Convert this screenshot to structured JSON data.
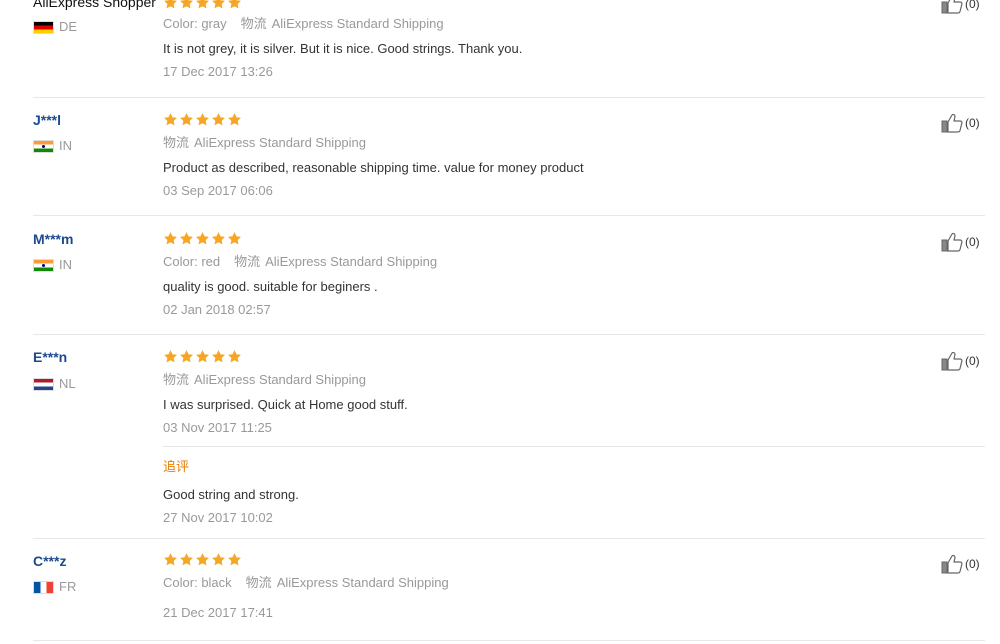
{
  "reviews": [
    {
      "user": "AliExpress Shopper",
      "country": "DE",
      "flag": "de",
      "rating": 5,
      "color_label": "Color:",
      "color": "gray",
      "shipping_label": "物流",
      "shipping": "AliExpress Standard Shipping",
      "text": "It is not grey, it is silver. But it is nice. Good strings. Thank you.",
      "date": "17 Dec 2017 13:26",
      "likes": "(0)"
    },
    {
      "user": "J***l",
      "country": "IN",
      "flag": "in",
      "rating": 5,
      "shipping_label": "物流",
      "shipping": "AliExpress Standard Shipping",
      "text": "Product as described, reasonable shipping time. value for money product",
      "date": "03 Sep 2017 06:06",
      "likes": "(0)"
    },
    {
      "user": "M***m",
      "country": "IN",
      "flag": "in",
      "rating": 5,
      "color_label": "Color:",
      "color": "red",
      "shipping_label": "物流",
      "shipping": "AliExpress Standard Shipping",
      "text": "quality is good. suitable for beginers .",
      "date": "02 Jan 2018 02:57",
      "likes": "(0)"
    },
    {
      "user": "E***n",
      "country": "NL",
      "flag": "nl",
      "rating": 5,
      "shipping_label": "物流",
      "shipping": "AliExpress Standard Shipping",
      "text": "I was surprised. Quick at Home good stuff.",
      "date": "03 Nov 2017 11:25",
      "followup_label": "追评",
      "followup_text": "Good string and strong.",
      "followup_date": "27 Nov 2017 10:02",
      "likes": "(0)"
    },
    {
      "user": "C***z",
      "country": "FR",
      "flag": "fr",
      "rating": 5,
      "color_label": "Color:",
      "color": "black",
      "shipping_label": "物流",
      "shipping": "AliExpress Standard Shipping",
      "date": "21 Dec 2017 17:41",
      "likes": "(0)"
    }
  ],
  "colors": {
    "star": "#f5a623",
    "username": "#1d4a8d",
    "followup": "#e97d00"
  },
  "icons": {
    "like": "thumbs-up-icon",
    "star": "star-icon"
  }
}
